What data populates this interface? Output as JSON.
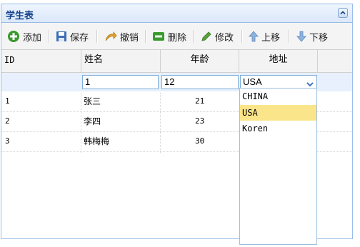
{
  "panel": {
    "title": "学生表"
  },
  "toolbar": {
    "add": "添加",
    "save": "保存",
    "undo": "撤销",
    "delete": "删除",
    "edit": "修改",
    "move_up": "上移",
    "move_down": "下移"
  },
  "columns": {
    "id": "ID",
    "name": "姓名",
    "age": "年龄",
    "address": "地址"
  },
  "editor": {
    "name": "1",
    "age": "12",
    "address": "USA"
  },
  "rows": [
    {
      "id": "1",
      "name": "张三",
      "age": "21"
    },
    {
      "id": "2",
      "name": "李四",
      "age": "23"
    },
    {
      "id": "3",
      "name": "韩梅梅",
      "age": "30"
    }
  ],
  "dropdown": {
    "options": [
      "CHINA",
      "USA",
      "Koren"
    ],
    "selected": "USA"
  },
  "colors": {
    "header_text": "#15428b",
    "selected_option": "#fae58a",
    "editor_row": "#e7f0fc"
  }
}
